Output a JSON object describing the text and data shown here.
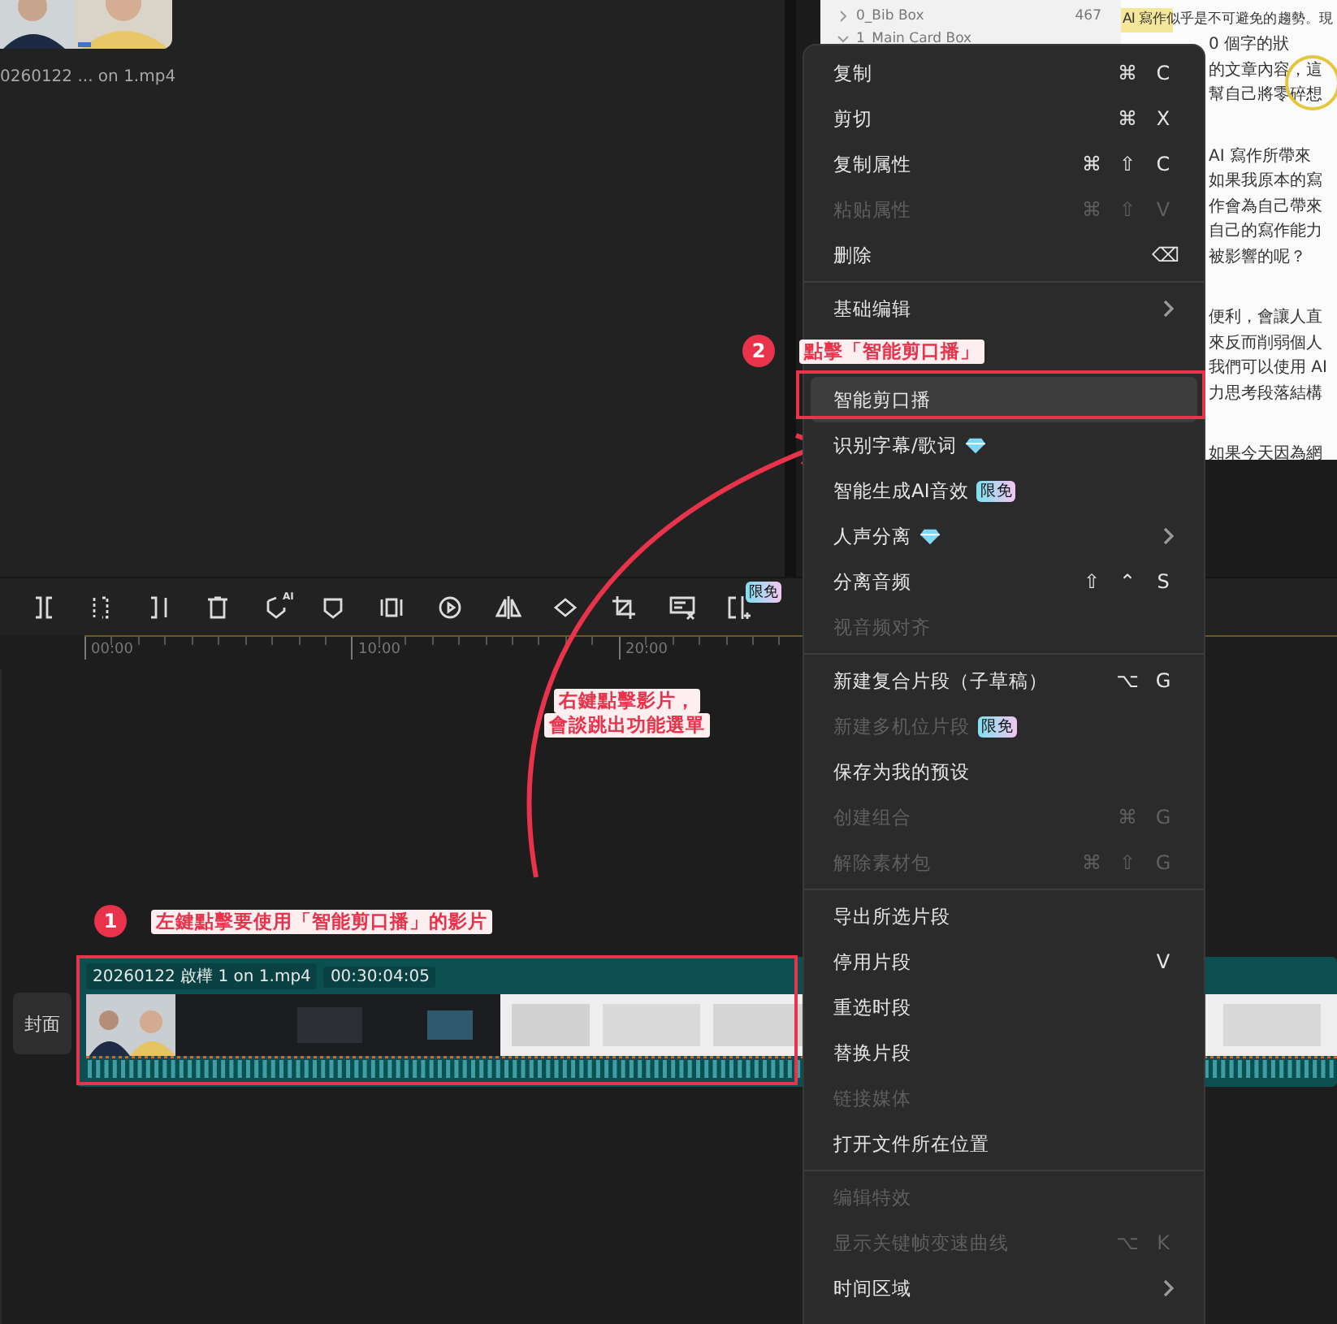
{
  "media_panel": {
    "filename": "0260122 ... on 1.mp4"
  },
  "document": {
    "sidebar": [
      {
        "label": "0_Bib Box",
        "count": "467",
        "expanded": false
      },
      {
        "label": "1_Main Card Box",
        "expanded": true
      }
    ],
    "lead": "AI 寫作似乎是不可避免的趨勢。現",
    "paragraphs": [
      [
        "0 個字的狀",
        "的文章內容，這",
        "幫自己將零碎想"
      ],
      [
        "AI 寫作所帶來",
        "如果我原本的寫",
        "作會為自己帶來",
        "自己的寫作能力",
        "被影響的呢？"
      ],
      [
        "便利，會讓人直",
        "來反而削弱個人",
        "我們可以使用 AI",
        "力思考段落結構"
      ],
      [
        "如果今天因為網"
      ]
    ]
  },
  "toolbar": {
    "ai_tag": "AI",
    "badge": "限免"
  },
  "ruler": {
    "labels": [
      "00:00",
      "10:00",
      "20:00"
    ]
  },
  "timeline": {
    "cover_button": "封面",
    "clip": {
      "name": "20260122 啟樺 1 on 1.mp4",
      "duration": "00:30:04:05"
    }
  },
  "context_menu": {
    "groups": [
      [
        {
          "label": "复制",
          "disabled": false,
          "highlighted": false,
          "submenu": false,
          "gem": false,
          "shortcut": [
            "⌘",
            "C"
          ]
        },
        {
          "label": "剪切",
          "disabled": false,
          "highlighted": false,
          "submenu": false,
          "gem": false,
          "shortcut": [
            "⌘",
            "X"
          ]
        },
        {
          "label": "复制属性",
          "disabled": false,
          "highlighted": false,
          "submenu": false,
          "gem": false,
          "shortcut": [
            "⌘",
            "⇧",
            "C"
          ]
        },
        {
          "label": "粘贴属性",
          "disabled": true,
          "highlighted": false,
          "submenu": false,
          "gem": false,
          "shortcut": [
            "⌘",
            "⇧",
            "V"
          ]
        },
        {
          "label": "删除",
          "disabled": false,
          "highlighted": false,
          "submenu": false,
          "gem": false,
          "shortcut": [
            "⌫"
          ]
        }
      ],
      [
        {
          "label": "基础编辑",
          "disabled": false,
          "highlighted": false,
          "submenu": true,
          "gem": false
        },
        {
          "label": "智能剪口播",
          "disabled": false,
          "highlighted": true,
          "submenu": false,
          "gem": false
        },
        {
          "label": "识别字幕/歌词",
          "disabled": false,
          "highlighted": false,
          "submenu": false,
          "gem": true
        },
        {
          "label": "智能生成AI音效",
          "disabled": false,
          "highlighted": false,
          "submenu": false,
          "gem": false,
          "badge": "限免"
        },
        {
          "label": "人声分离",
          "disabled": false,
          "highlighted": false,
          "submenu": true,
          "gem": true
        },
        {
          "label": "分离音频",
          "disabled": false,
          "highlighted": false,
          "submenu": false,
          "gem": false,
          "shortcut": [
            "⇧",
            "⌃",
            "S"
          ]
        },
        {
          "label": "视音频对齐",
          "disabled": true,
          "highlighted": false,
          "submenu": false,
          "gem": false
        }
      ],
      [
        {
          "label": "新建复合片段（子草稿）",
          "disabled": false,
          "highlighted": false,
          "submenu": false,
          "gem": false,
          "shortcut": [
            "⌥",
            "G"
          ]
        },
        {
          "label": "新建多机位片段",
          "disabled": true,
          "highlighted": false,
          "submenu": false,
          "gem": false,
          "badge": "限免"
        },
        {
          "label": "保存为我的预设",
          "disabled": false,
          "highlighted": false,
          "submenu": false,
          "gem": false
        },
        {
          "label": "创建组合",
          "disabled": true,
          "highlighted": false,
          "submenu": false,
          "gem": false,
          "shortcut": [
            "⌘",
            "G"
          ]
        },
        {
          "label": "解除素材包",
          "disabled": true,
          "highlighted": false,
          "submenu": false,
          "gem": false,
          "shortcut": [
            "⌘",
            "⇧",
            "G"
          ]
        }
      ],
      [
        {
          "label": "导出所选片段",
          "disabled": false,
          "highlighted": false,
          "submenu": false,
          "gem": false
        },
        {
          "label": "停用片段",
          "disabled": false,
          "highlighted": false,
          "submenu": false,
          "gem": false,
          "shortcut": [
            "V"
          ]
        },
        {
          "label": "重选时段",
          "disabled": false,
          "highlighted": false,
          "submenu": false,
          "gem": false
        },
        {
          "label": "替换片段",
          "disabled": false,
          "highlighted": false,
          "submenu": false,
          "gem": false
        },
        {
          "label": "链接媒体",
          "disabled": true,
          "highlighted": false,
          "submenu": false,
          "gem": false
        },
        {
          "label": "打开文件所在位置",
          "disabled": false,
          "highlighted": false,
          "submenu": false,
          "gem": false
        }
      ],
      [
        {
          "label": "编辑特效",
          "disabled": true,
          "highlighted": false,
          "submenu": false,
          "gem": false
        },
        {
          "label": "显示关键帧变速曲线",
          "disabled": true,
          "highlighted": false,
          "submenu": false,
          "gem": false,
          "shortcut": [
            "⌥",
            "K"
          ]
        },
        {
          "label": "时间区域",
          "disabled": false,
          "highlighted": false,
          "submenu": true,
          "gem": false
        }
      ]
    ]
  },
  "annotations": [
    {
      "kind": "step",
      "number": "1",
      "text": "左鍵點擊要使用「智能剪口播」的影片"
    },
    {
      "kind": "step",
      "number": "2",
      "text": "點擊「智能剪口播」"
    },
    {
      "kind": "note",
      "lines": [
        "右鍵點擊影片，",
        "會談跳出功能選單"
      ]
    }
  ]
}
